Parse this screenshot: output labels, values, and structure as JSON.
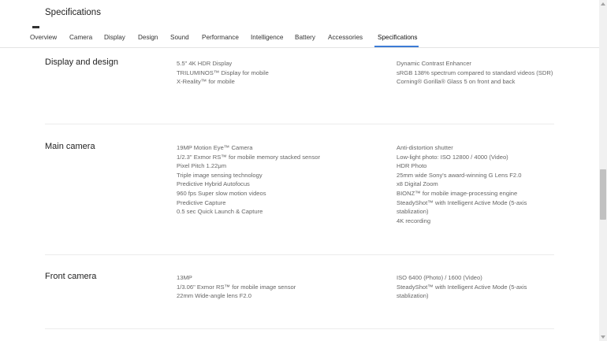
{
  "header": {
    "title": "Specifications"
  },
  "tabs": [
    {
      "label": "Overview"
    },
    {
      "label": "Camera"
    },
    {
      "label": "Display"
    },
    {
      "label": "Design"
    },
    {
      "label": "Sound"
    },
    {
      "label": "Performance"
    },
    {
      "label": "Intelligence"
    },
    {
      "label": "Battery"
    },
    {
      "label": "Accessories"
    },
    {
      "label": "Specifications"
    }
  ],
  "sections": [
    {
      "title": "Display and design",
      "col1": [
        "5.5\" 4K HDR Display",
        "TRILUMINOS™ Display for mobile",
        "X-Reality™ for mobile"
      ],
      "col2": [
        "Dynamic Contrast Enhancer",
        "sRGB 138% spectrum compared to standard videos (SDR)",
        "Corning® Gorilla® Glass 5 on front and back"
      ]
    },
    {
      "title": "Main camera",
      "col1": [
        "19MP Motion Eye™ Camera",
        "1/2.3\" Exmor RS™ for mobile memory stacked sensor",
        "Pixel Pitch 1.22μm",
        "Triple image sensing technology",
        "Predictive Hybrid Autofocus",
        "960 fps Super slow motion videos",
        "Predictive Capture",
        "0.5 sec Quick Launch & Capture"
      ],
      "col2": [
        "Anti-distortion shutter",
        "Low-light photo: ISO 12800 / 4000 (Video)",
        "HDR Photo",
        "25mm wide Sony's award-winning G Lens F2.0",
        "x8 Digital Zoom",
        "BIONZ™ for mobile image-processing engine",
        "SteadyShot™ with Intelligent Active Mode (5-axis stablization)",
        "4K recording"
      ]
    },
    {
      "title": "Front camera",
      "col1": [
        "13MP",
        "1/3.06\" Exmor RS™ for mobile image sensor",
        "22mm Wide-angle lens F2.0"
      ],
      "col2": [
        "ISO 6400 (Photo) / 1600 (Video)",
        "SteadyShot™ with Intelligent Active Mode (5-axis stablization)"
      ]
    }
  ]
}
